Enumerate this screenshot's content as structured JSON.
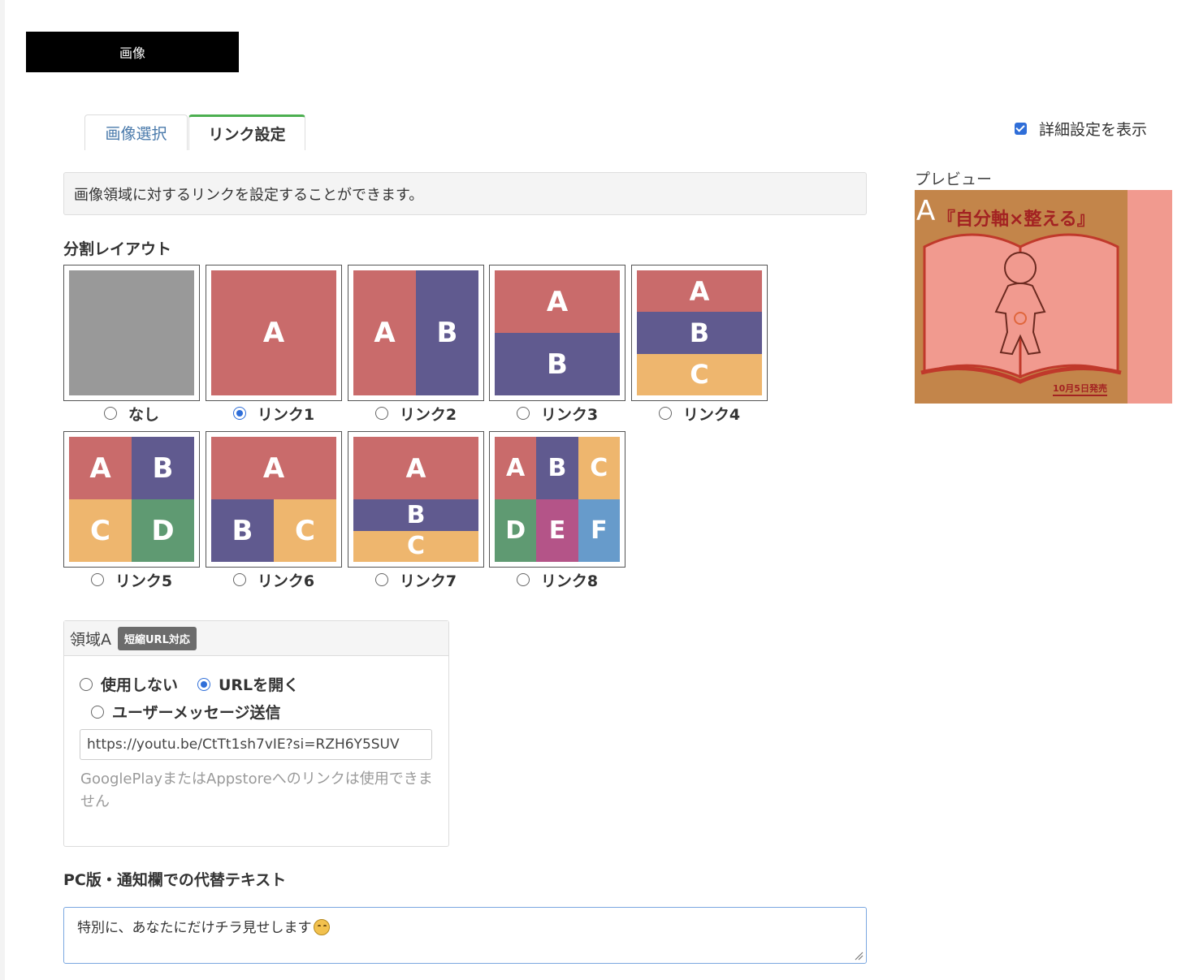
{
  "header": {
    "title": "画像"
  },
  "tabs": [
    {
      "label": "画像選択",
      "active": false
    },
    {
      "label": "リンク設定",
      "active": true
    }
  ],
  "info": {
    "text": "画像領域に対するリンクを設定することができます。"
  },
  "layout_section": {
    "title": "分割レイアウト",
    "selected": "リンク1",
    "options": [
      {
        "label": "なし",
        "checked": false
      },
      {
        "label": "リンク1",
        "checked": true
      },
      {
        "label": "リンク2",
        "checked": false
      },
      {
        "label": "リンク3",
        "checked": false
      },
      {
        "label": "リンク4",
        "checked": false
      },
      {
        "label": "リンク5",
        "checked": false
      },
      {
        "label": "リンク6",
        "checked": false
      },
      {
        "label": "リンク7",
        "checked": false
      },
      {
        "label": "リンク8",
        "checked": false
      }
    ],
    "cell_letters": [
      "A",
      "B",
      "C",
      "D",
      "E",
      "F"
    ]
  },
  "colors": {
    "gray": "#999999",
    "red": "#c96b6b",
    "purple": "#605a8f",
    "orange": "#eeb66e",
    "green": "#5f9a72",
    "magenta": "#b45488",
    "blue": "#679bcb",
    "accent_blue": "#2f6ed8",
    "tab_green": "#4caf50"
  },
  "area_panel": {
    "title": "領域A",
    "badge": "短縮URL対応",
    "options": [
      {
        "label": "使用しない",
        "checked": false
      },
      {
        "label": "URLを開く",
        "checked": true
      },
      {
        "label": "ユーザーメッセージ送信",
        "checked": false
      }
    ],
    "url_value": "https://youtu.be/CtTt1sh7vIE?si=RZH6Y5SUV",
    "help_text": "GooglePlayまたはAppstoreへのリンクは使用できません"
  },
  "alt_text": {
    "title": "PC版・通知欄での代替テキスト",
    "value": "特別に、あなたにだけチラ見せします",
    "emoji_icon": "smiling-face-emoji"
  },
  "detail_toggle": {
    "label": "詳細設定を表示",
    "checked": true
  },
  "preview": {
    "label": "プレビュー",
    "area_letter": "A",
    "title": "『自分軸×整える』",
    "release": "10月5日発売"
  }
}
